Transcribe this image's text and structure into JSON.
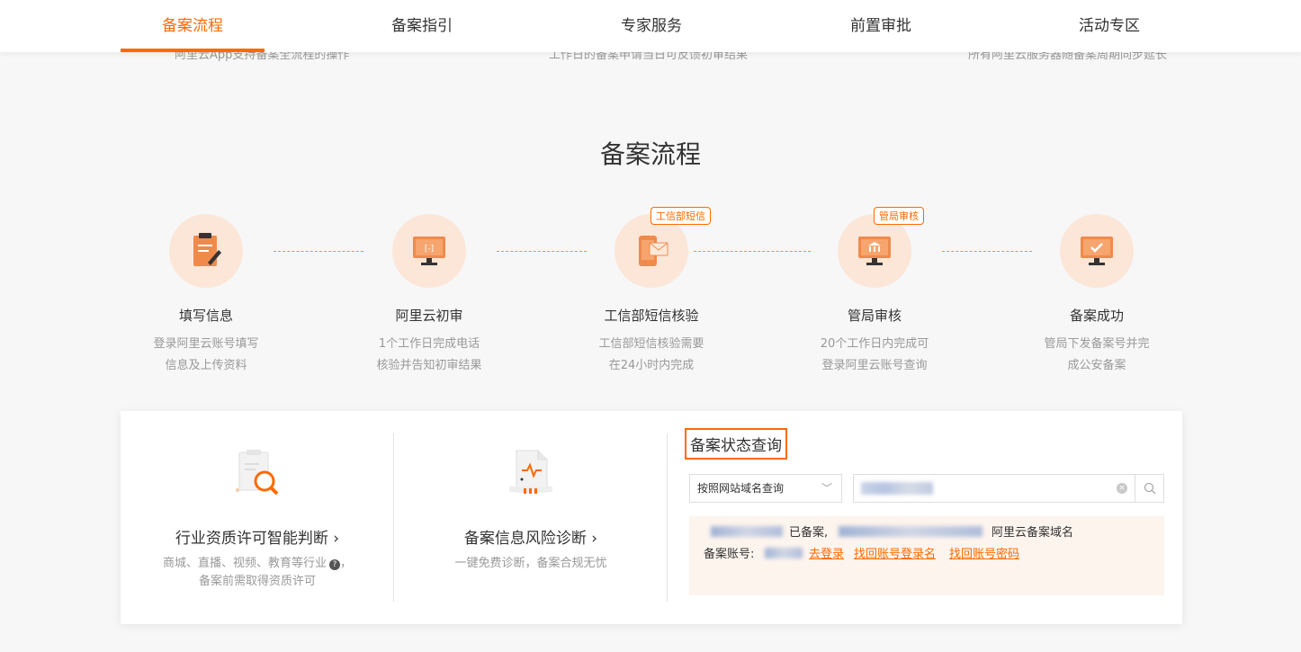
{
  "nav": {
    "tabs": [
      "备案流程",
      "备案指引",
      "专家服务",
      "前置审批",
      "活动专区"
    ],
    "active_index": 0
  },
  "peek": {
    "left": "阿里云App支持备案全流程的操作",
    "middle": "工作日的备案申请当日可反馈初审结果",
    "right": "所有阿里云服务器随备案周期同步延长"
  },
  "section_title": "备案流程",
  "steps": [
    {
      "title": "填写信息",
      "desc1": "登录阿里云账号填写",
      "desc2": "信息及上传资料",
      "icon": "form-edit-icon"
    },
    {
      "title": "阿里云初审",
      "desc1": "1个工作日完成电话",
      "desc2": "核验并告知初审结果",
      "icon": "monitor-icon"
    },
    {
      "title": "工信部短信核验",
      "desc1": "工信部短信核验需要",
      "desc2": "在24小时内完成",
      "icon": "sms-phone-icon",
      "badge": "工信部短信"
    },
    {
      "title": "管局审核",
      "desc1": "20个工作日内完成可",
      "desc2": "登录阿里云账号查询",
      "icon": "bureau-monitor-icon",
      "badge": "管局审核"
    },
    {
      "title": "备案成功",
      "desc1": "管局下发备案号并完",
      "desc2": "成公安备案",
      "icon": "check-monitor-icon"
    }
  ],
  "panels": {
    "license": {
      "title": "行业资质许可智能判断 ›",
      "desc1": "商城、直播、视频、教育等行业",
      "desc2": "备案前需取得资质许可"
    },
    "risk": {
      "title": "备案信息风险诊断 ›",
      "desc": "一键免费诊断，备案合规无忧"
    }
  },
  "query": {
    "title": "备案状态查询",
    "select_value": "按照网站域名查询",
    "result_status": "已备案,",
    "result_suffix": "阿里云备案域名",
    "account_label": "备案账号:",
    "links": [
      "去登录",
      "找回账号登录名",
      "找回账号密码"
    ]
  },
  "colors": {
    "accent": "#ff6a00",
    "circle_bg": "#fbe6d8"
  }
}
